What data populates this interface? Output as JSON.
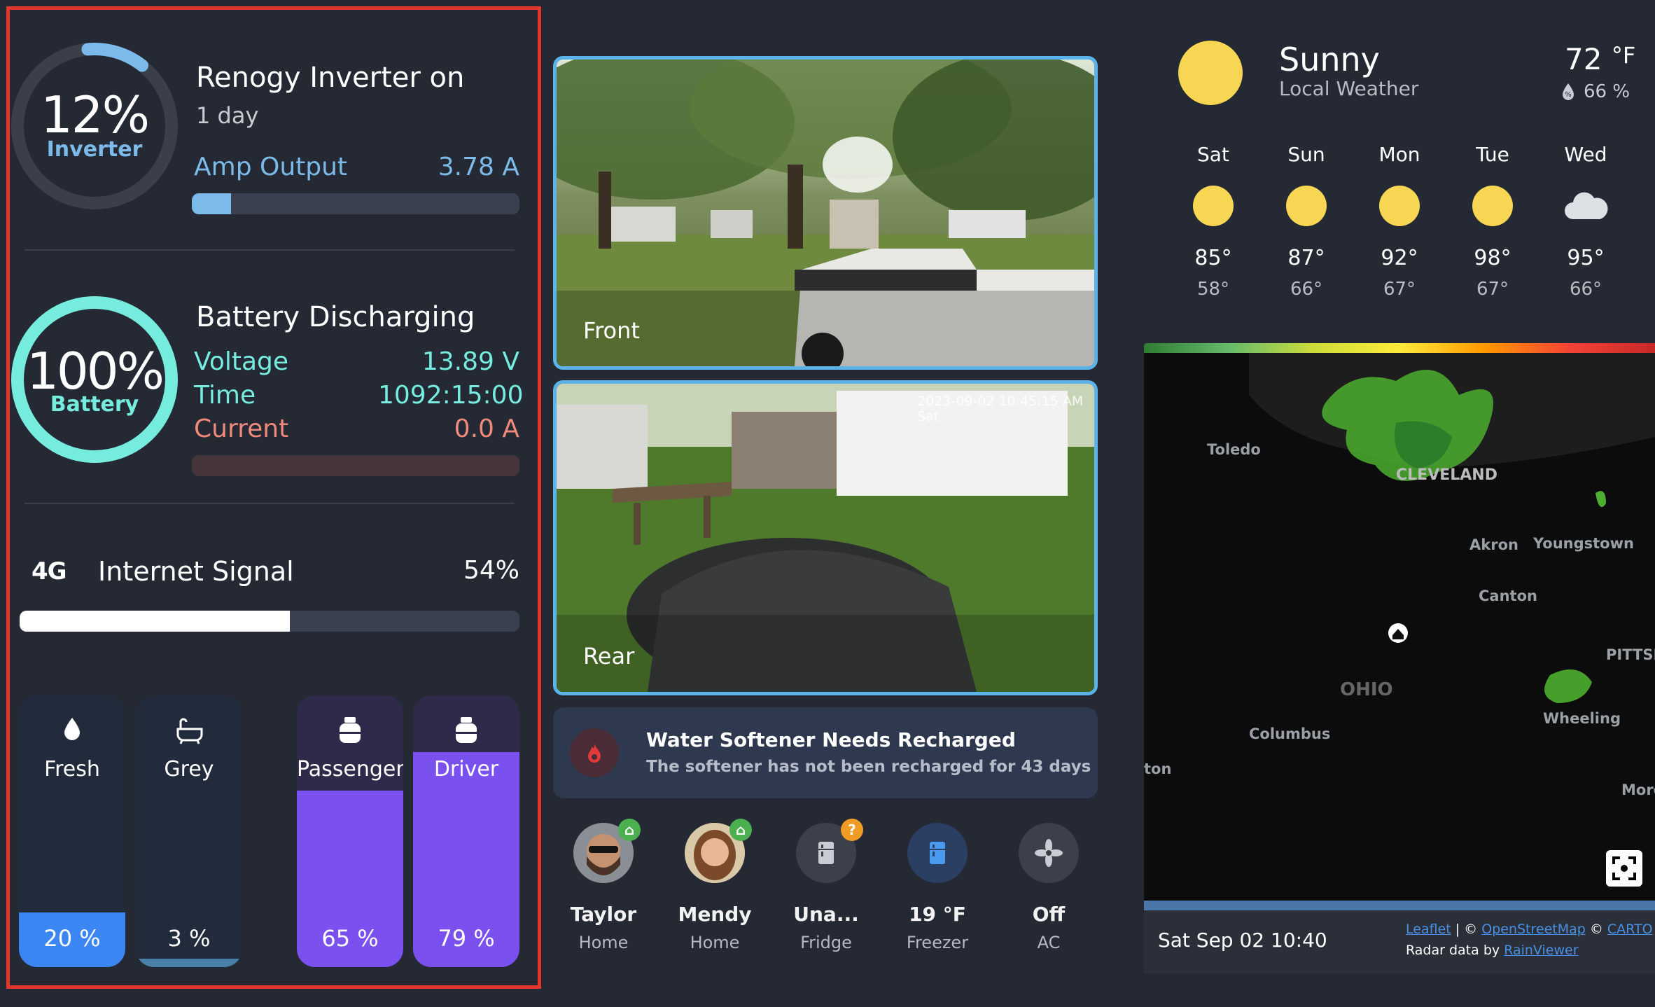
{
  "inverter": {
    "percent": "12%",
    "label": "Inverter",
    "title": "Renogy Inverter on",
    "duration": "1 day",
    "amp_label": "Amp Output",
    "amp_value": "3.78 A",
    "amp_fraction": 0.12
  },
  "battery": {
    "percent": "100%",
    "label": "Battery",
    "title": "Battery Discharging",
    "voltage_label": "Voltage",
    "voltage_value": "13.89 V",
    "time_label": "Time",
    "time_value": "1092:15:00",
    "current_label": "Current",
    "current_value": "0.0 A"
  },
  "internet": {
    "badge": "4G",
    "label": "Internet Signal",
    "value": "54%",
    "fraction": 0.54
  },
  "tanks": [
    {
      "name": "Fresh",
      "value": "20 %",
      "fraction": 0.2,
      "color": "#3b86f2",
      "icon": "water-drop-icon"
    },
    {
      "name": "Grey",
      "value": "3 %",
      "fraction": 0.03,
      "color": "#4a7fa8",
      "icon": "bathtub-icon"
    },
    {
      "name": "Passenger",
      "value": "65 %",
      "fraction": 0.65,
      "color": "#7a51ee",
      "icon": "propane-tank-icon"
    },
    {
      "name": "Driver",
      "value": "79 %",
      "fraction": 0.79,
      "color": "#7a51ee",
      "icon": "propane-tank-icon"
    }
  ],
  "cameras": {
    "front_label": "Front",
    "rear_label": "Rear",
    "rear_timestamp": "2023-09-02 10:45:15 AM Sat"
  },
  "alert": {
    "title": "Water Softener Needs Recharged",
    "message": "The softener has not been recharged for 43 days",
    "icon": "fire-icon"
  },
  "entities": [
    {
      "name": "Taylor",
      "state": "Home",
      "icon": "avatar",
      "badge": "home-icon"
    },
    {
      "name": "Mendy",
      "state": "Home",
      "icon": "avatar",
      "badge": "home-icon"
    },
    {
      "name": "Una...",
      "state": "Fridge",
      "icon": "fridge-icon",
      "badge": "?"
    },
    {
      "name": "19 °F",
      "state": "Freezer",
      "icon": "fridge-icon"
    },
    {
      "name": "Off",
      "state": "AC",
      "icon": "fan-icon"
    }
  ],
  "weather": {
    "condition": "Sunny",
    "source": "Local Weather",
    "temp": "72",
    "unit": "°F",
    "humidity": "66 %",
    "forecast": [
      {
        "day": "Sat",
        "high": "85°",
        "low": "58°",
        "icon": "sun-icon"
      },
      {
        "day": "Sun",
        "high": "87°",
        "low": "66°",
        "icon": "sun-icon"
      },
      {
        "day": "Mon",
        "high": "92°",
        "low": "67°",
        "icon": "sun-icon"
      },
      {
        "day": "Tue",
        "high": "98°",
        "low": "67°",
        "icon": "sun-icon"
      },
      {
        "day": "Wed",
        "high": "95°",
        "low": "66°",
        "icon": "cloud-icon"
      }
    ]
  },
  "map": {
    "cities": [
      "Toledo",
      "CLEVELAND",
      "Akron",
      "Youngstown",
      "Canton",
      "PITTSB",
      "OHIO",
      "Columbus",
      "Wheeling",
      "ton",
      "Morg"
    ],
    "timestamp": "Sat Sep 02 10:40",
    "leaflet": "Leaflet",
    "sep1": " | © ",
    "osm": "OpenStreetMap",
    "sep2": " © ",
    "carto": "CARTO",
    "radar_prefix": "Radar data by ",
    "rainviewer": "RainViewer"
  }
}
